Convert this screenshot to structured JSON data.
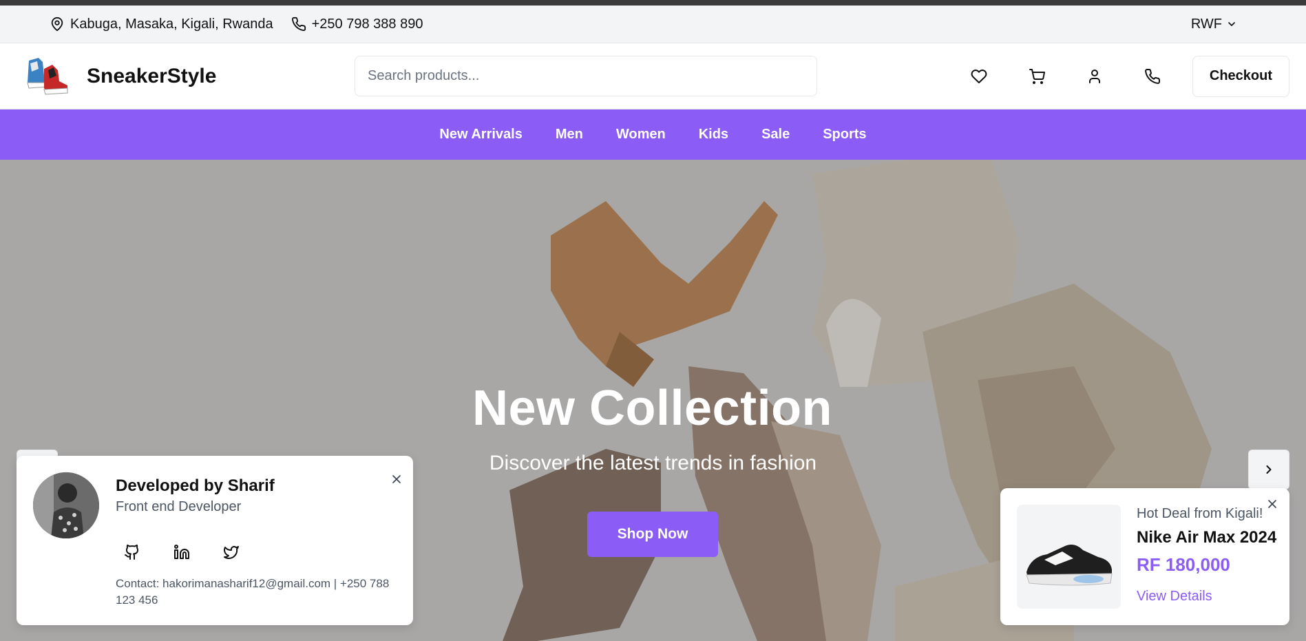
{
  "infobar": {
    "address": "Kabuga, Masaka, Kigali, Rwanda",
    "phone": "+250 798 388 890",
    "currency": "RWF"
  },
  "header": {
    "brand_name": "SneakerStyle",
    "search_placeholder": "Search products...",
    "checkout_label": "Checkout",
    "icons": [
      "heart-icon",
      "cart-icon",
      "user-icon",
      "phone-icon"
    ]
  },
  "nav": {
    "items": [
      "New Arrivals",
      "Men",
      "Women",
      "Kids",
      "Sale",
      "Sports"
    ]
  },
  "hero": {
    "title": "New Collection",
    "subtitle": "Discover the latest trends in fashion",
    "cta_label": "Shop Now"
  },
  "dev_card": {
    "name": "Developed by Sharif",
    "role": "Front end Developer",
    "socials": [
      "github-icon",
      "linkedin-icon",
      "twitter-icon"
    ],
    "contact": "Contact: hakorimanasharif12@gmail.com | +250 788 123 456"
  },
  "deal_card": {
    "tag": "Hot Deal from Kigali!",
    "product": "Nike Air Max 2024",
    "price": "RF 180,000",
    "link_label": "View Details"
  },
  "colors": {
    "accent": "#8b5cf6",
    "topbar": "#3a3b3a",
    "infobar_bg": "#f3f4f6"
  }
}
